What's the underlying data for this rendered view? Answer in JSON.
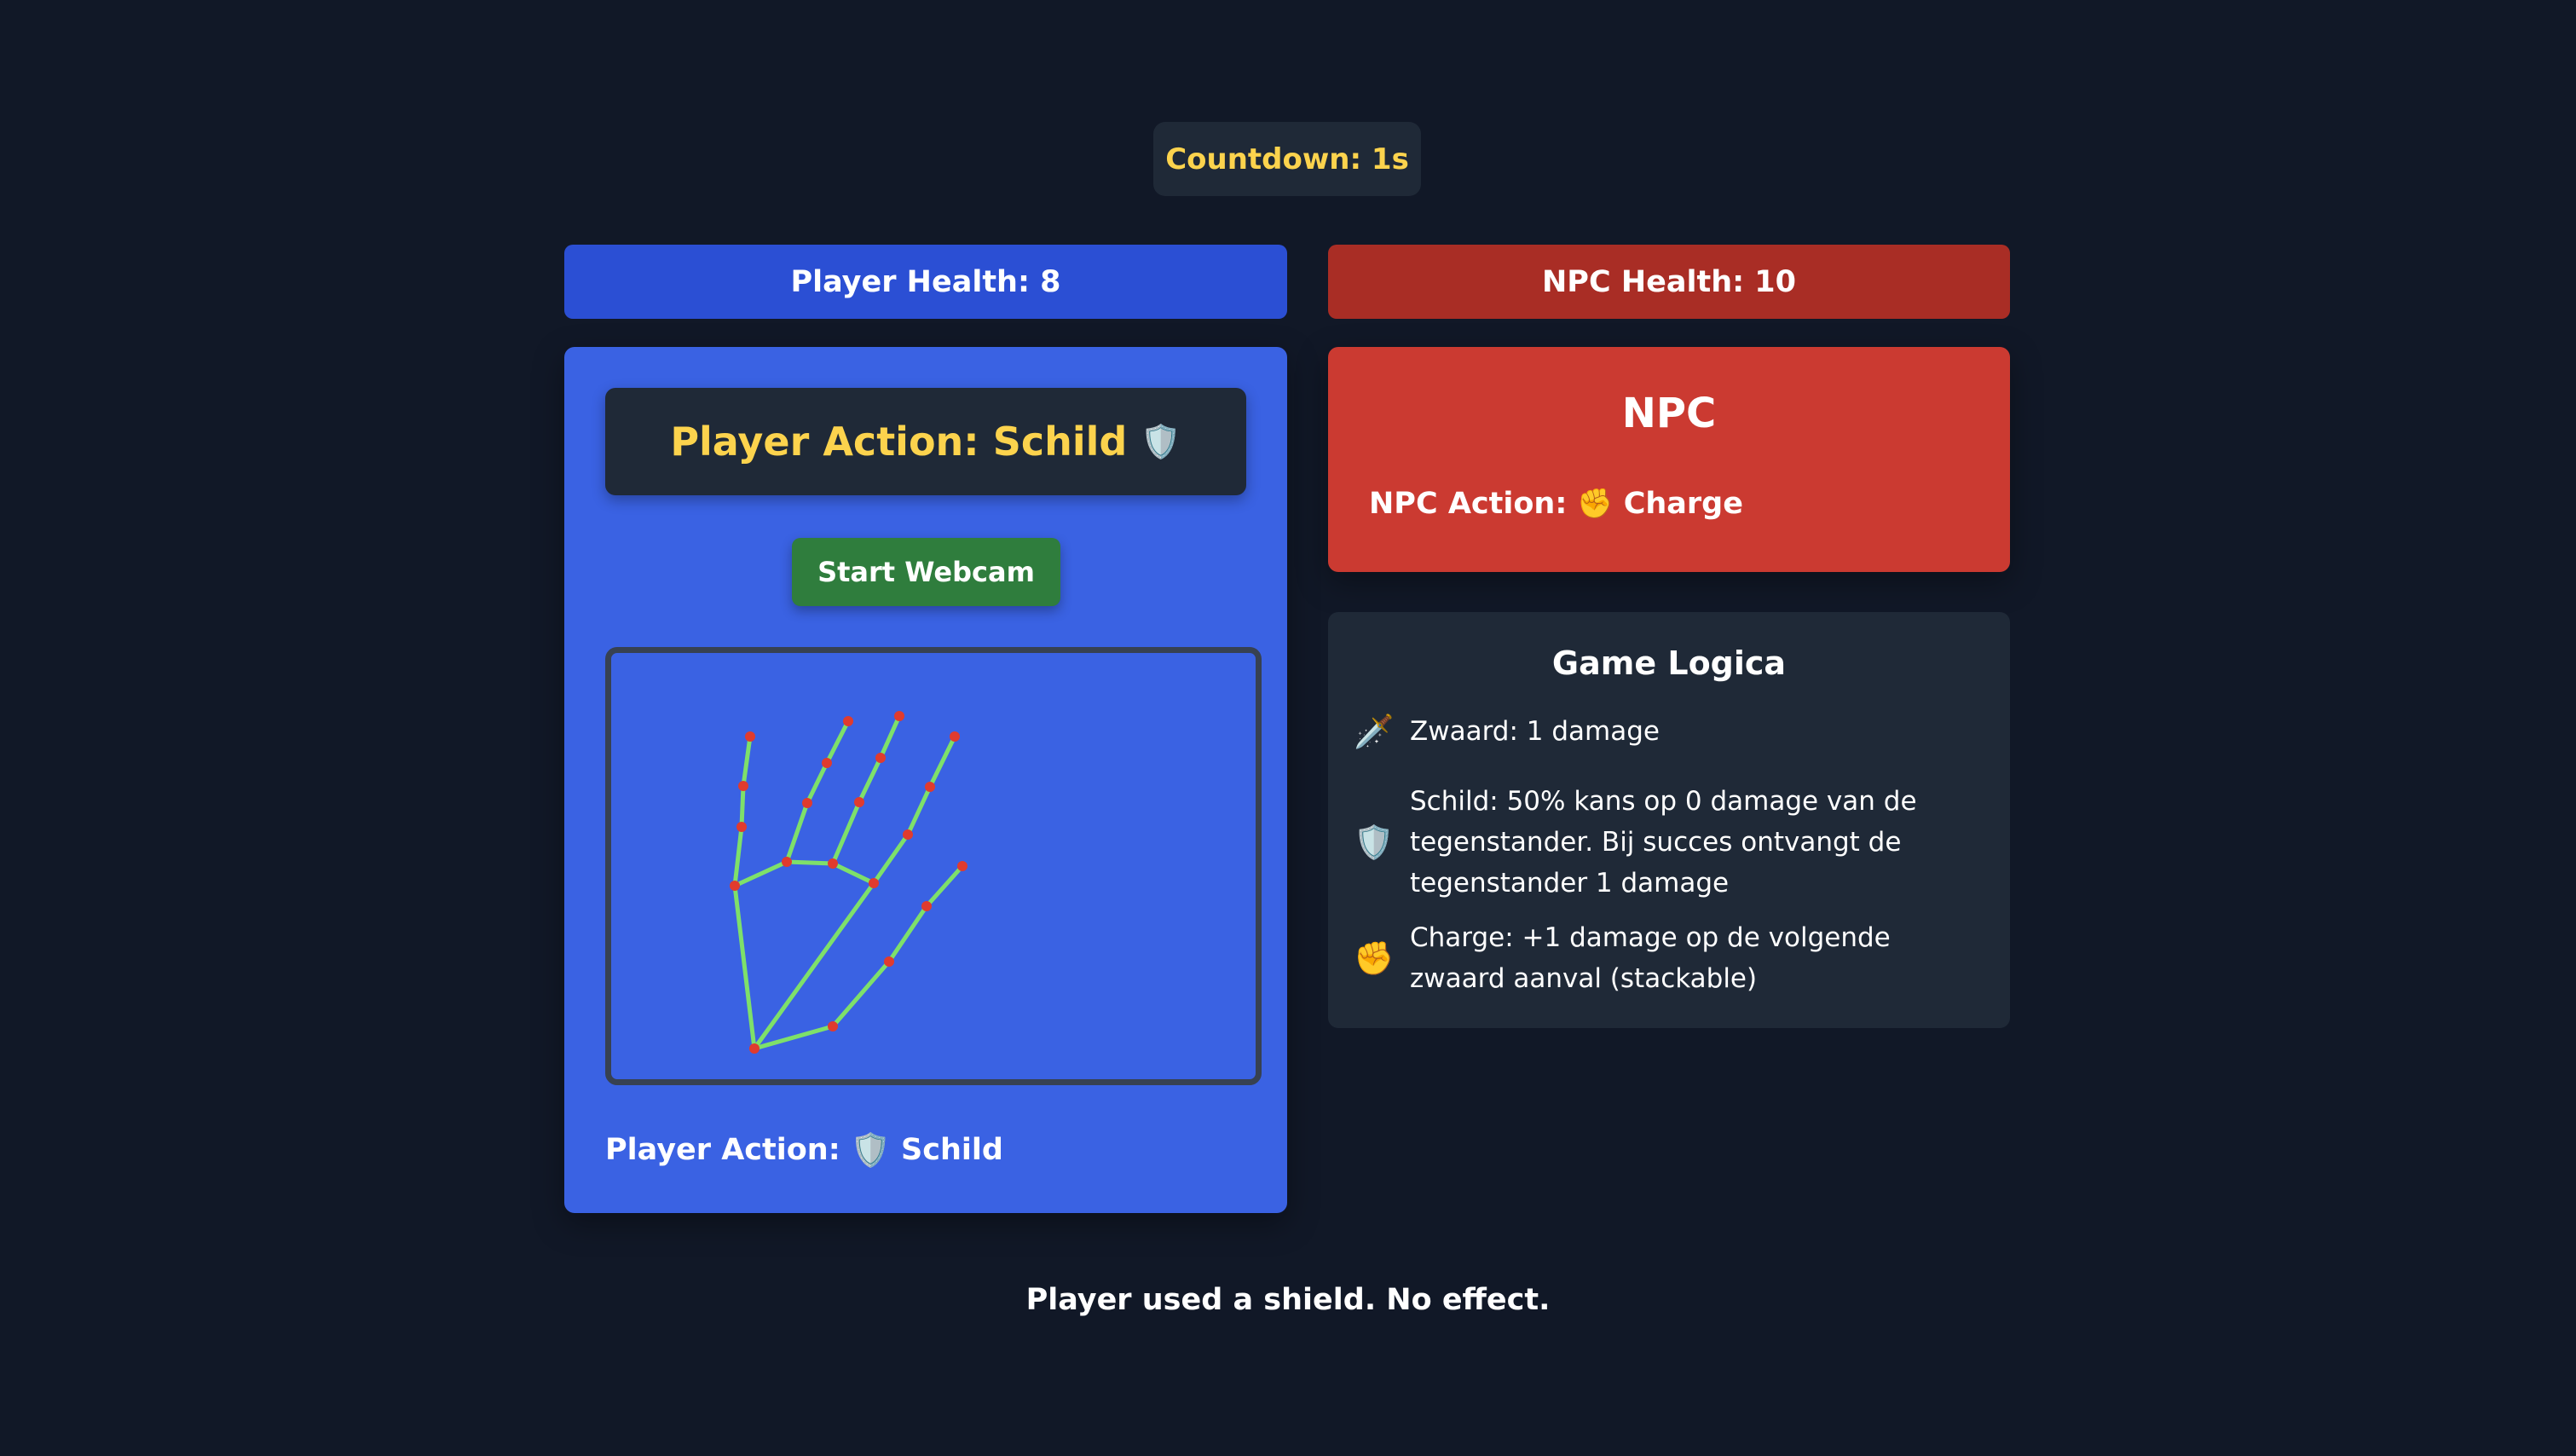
{
  "countdown": "Countdown: 1s",
  "player": {
    "health_label": "Player Health: 8",
    "action_heading": "Player Action: Schild",
    "action_icon": "shield-icon",
    "webcam_button": "Start Webcam",
    "footer_prefix": "Player Action:",
    "footer_action": "Schild"
  },
  "npc": {
    "health_label": "NPC Health: 10",
    "title": "NPC",
    "action_prefix": "NPC Action:",
    "action_icon": "fist-icon",
    "action": "Charge"
  },
  "game_logic": {
    "title": "Game Logica",
    "rules": [
      {
        "icon": "sword-icon",
        "text": "Zwaard: 1 damage"
      },
      {
        "icon": "shield-icon",
        "text": "Schild: 50% kans op 0 damage van de tegenstander. Bij succes ontvangt de tegenstander 1 damage"
      },
      {
        "icon": "fist-icon",
        "text": "Charge: +1 damage op de volgende zwaard aanval (stackable)"
      }
    ]
  },
  "message": "Player used a shield. No effect.",
  "colors": {
    "background": "#111827",
    "player_panel": "#3a62e3",
    "npc_panel": "#cb3a31",
    "highlight_text": "#fcd34d",
    "webcam_button": "#2f7d3d",
    "hand_line": "#7ee06a",
    "hand_joint": "#e03b2e"
  }
}
